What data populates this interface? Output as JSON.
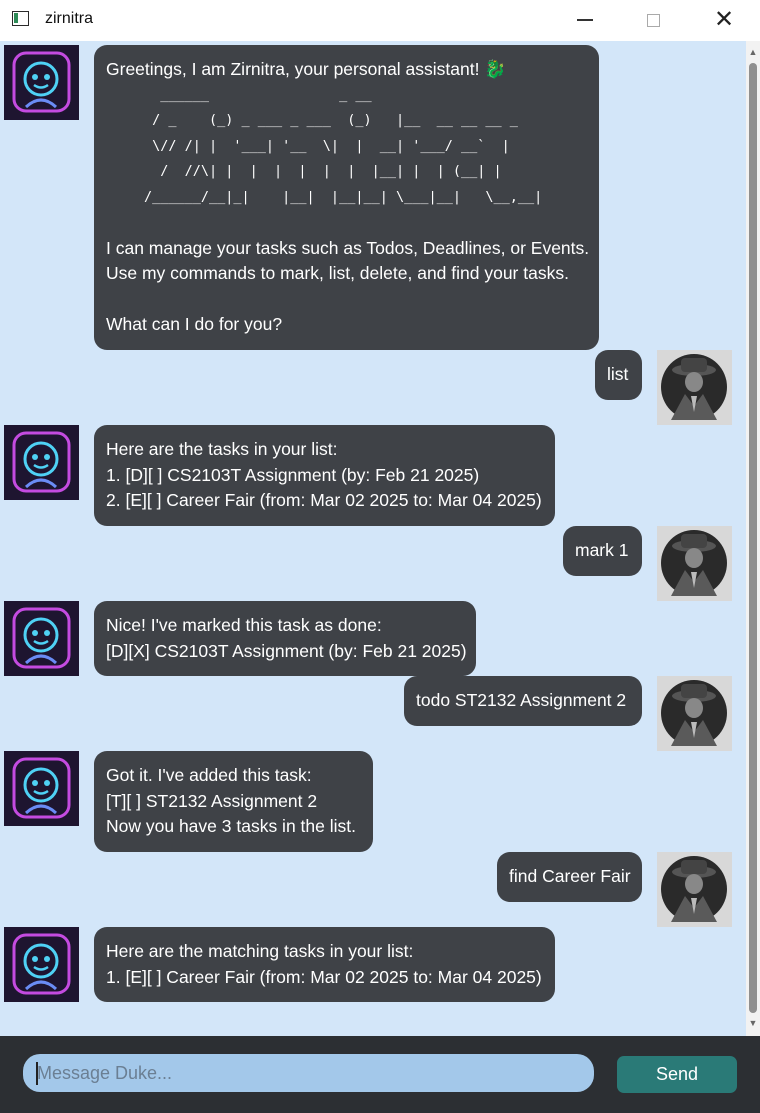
{
  "window": {
    "title": "zirnitra"
  },
  "bot_greeting": {
    "lines": [
      "Greetings, I am Zirnitra, your personal assistant! 🐉"
    ],
    "ascii": [
      "  ______                _ __",
      " / _    (_) _ ___ _ ___  (_)   |__  __ __ __ _",
      " \\// /| |  '___| '__  \\|  |  __| '___/ __`  |",
      "  /  //\\| |  |  |  |  |  |  |__| |  | (__| |",
      "/______/__|_|    |__|  |__|__| \\___|__|   \\__,__|"
    ],
    "after": [
      "I can manage your tasks such as Todos, Deadlines, or Events.",
      "Use my commands to mark, list, delete, and find your tasks.",
      "",
      "What can I do for you?"
    ]
  },
  "messages": [
    {
      "from": "user",
      "lines": [
        "list"
      ]
    },
    {
      "from": "bot",
      "lines": [
        "Here are the tasks in your list:",
        "1. [D][ ] CS2103T Assignment (by: Feb 21 2025)",
        "2. [E][ ] Career Fair (from: Mar 02 2025 to: Mar 04 2025)"
      ]
    },
    {
      "from": "user",
      "lines": [
        "mark 1"
      ]
    },
    {
      "from": "bot",
      "lines": [
        "Nice! I've marked this task as done:",
        "[D][X] CS2103T Assignment (by: Feb 21 2025)"
      ]
    },
    {
      "from": "user",
      "lines": [
        "todo ST2132 Assignment 2"
      ]
    },
    {
      "from": "bot",
      "lines": [
        "Got it. I've added this task:",
        "[T][ ] ST2132 Assignment 2",
        "Now you have 3 tasks in the list."
      ]
    },
    {
      "from": "user",
      "lines": [
        "find Career Fair"
      ]
    },
    {
      "from": "bot",
      "lines": [
        "Here are the matching tasks in your list:",
        "1. [E][ ] Career Fair (from: Mar 02 2025 to: Mar 04 2025)"
      ]
    }
  ],
  "input": {
    "placeholder": "Message Duke...",
    "value": ""
  },
  "send_label": "Send",
  "icons": {
    "bot_avatar": "robot-avatar-icon",
    "user_avatar": "detective-avatar-icon"
  }
}
